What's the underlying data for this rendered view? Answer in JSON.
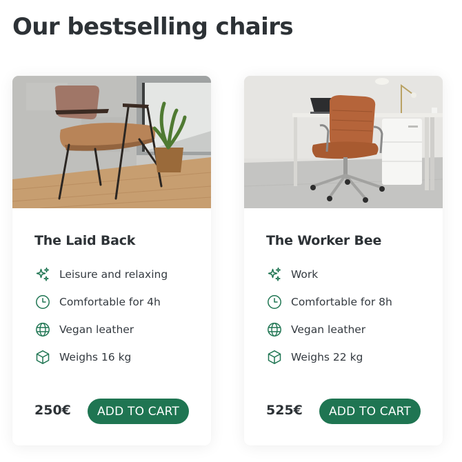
{
  "page": {
    "title": "Our bestselling chairs"
  },
  "accent_color": "#1f7552",
  "products": [
    {
      "name": "The Laid Back",
      "image_icon": "lounge-chair-photo",
      "attributes": [
        {
          "icon": "sparkles-icon",
          "text": "Leisure and relaxing"
        },
        {
          "icon": "clock-icon",
          "text": "Comfortable for 4h"
        },
        {
          "icon": "globe-icon",
          "text": "Vegan leather"
        },
        {
          "icon": "cube-icon",
          "text": "Weighs 16 kg"
        }
      ],
      "price": "250€",
      "cta": "ADD TO CART"
    },
    {
      "name": "The Worker Bee",
      "image_icon": "office-chair-photo",
      "attributes": [
        {
          "icon": "sparkles-icon",
          "text": "Work"
        },
        {
          "icon": "clock-icon",
          "text": "Comfortable for 8h"
        },
        {
          "icon": "globe-icon",
          "text": "Vegan leather"
        },
        {
          "icon": "cube-icon",
          "text": "Weighs 22 kg"
        }
      ],
      "price": "525€",
      "cta": "ADD TO CART"
    }
  ]
}
